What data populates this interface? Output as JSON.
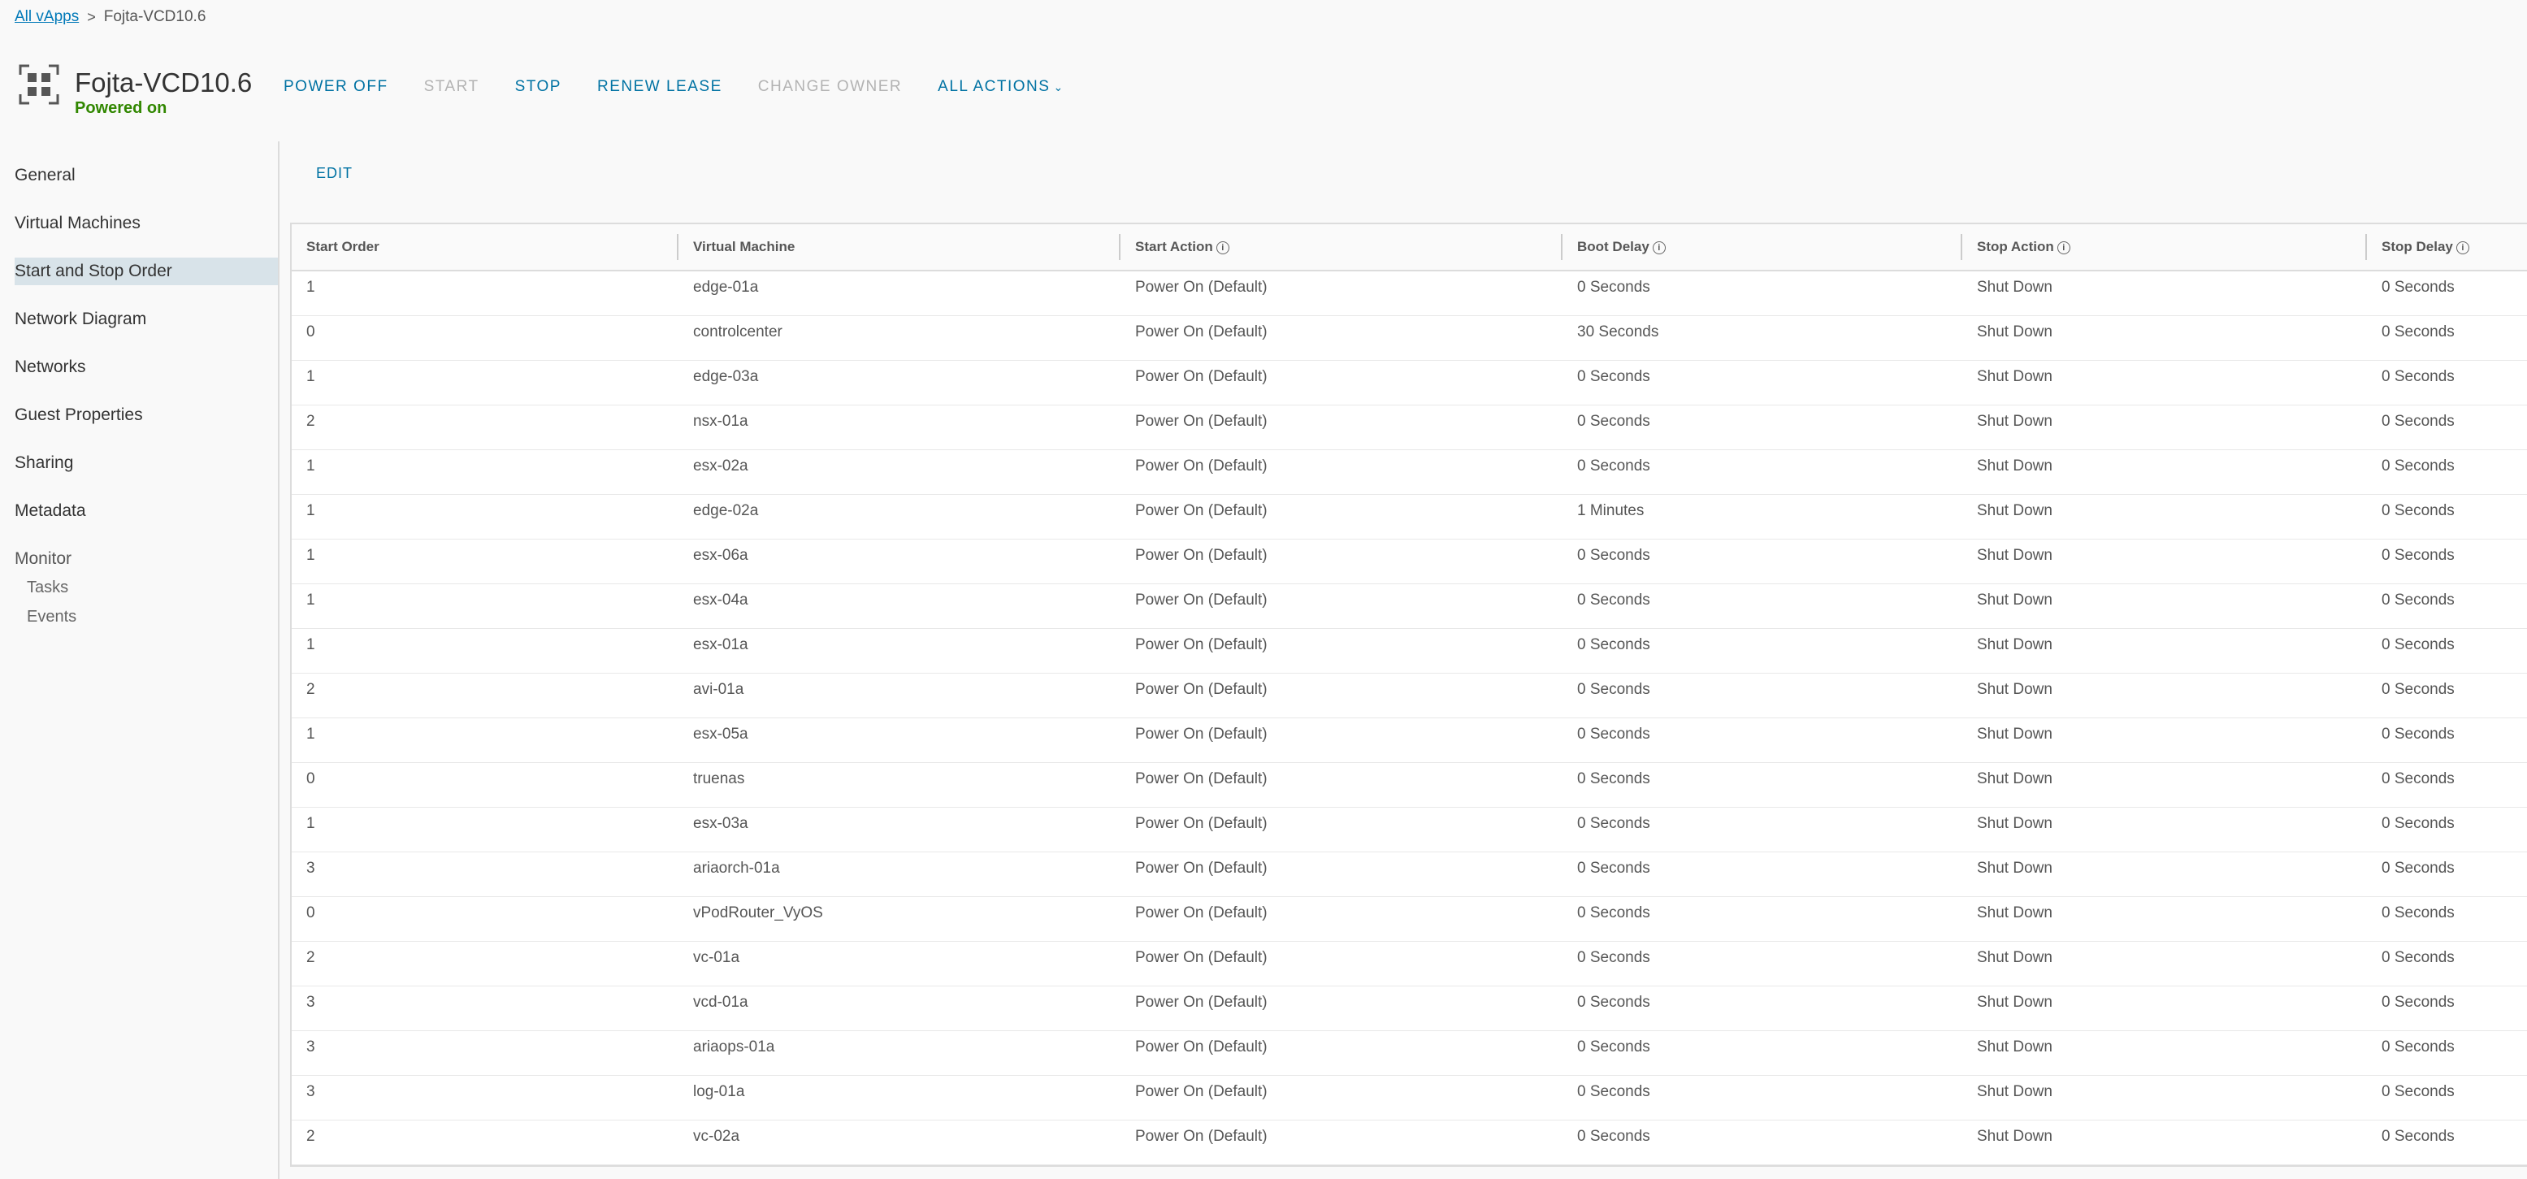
{
  "breadcrumb": {
    "root": "All vApps",
    "separator": ">",
    "current": "Fojta-VCD10.6"
  },
  "header": {
    "icon": "vapp-icon",
    "title": "Fojta-VCD10.6",
    "status": "Powered on",
    "status_color": "#318700"
  },
  "actions": [
    {
      "label": "POWER OFF",
      "enabled": true
    },
    {
      "label": "START",
      "enabled": false
    },
    {
      "label": "STOP",
      "enabled": true
    },
    {
      "label": "RENEW LEASE",
      "enabled": true
    },
    {
      "label": "CHANGE OWNER",
      "enabled": false
    },
    {
      "label": "ALL ACTIONS",
      "enabled": true,
      "icon": "chevron-down-icon"
    }
  ],
  "sidebar": {
    "items": [
      {
        "label": "General"
      },
      {
        "label": "Virtual Machines"
      },
      {
        "label": "Start and Stop Order",
        "active": true
      },
      {
        "label": "Network Diagram"
      },
      {
        "label": "Networks"
      },
      {
        "label": "Guest Properties"
      },
      {
        "label": "Sharing"
      },
      {
        "label": "Metadata"
      }
    ],
    "monitor": {
      "label": "Monitor",
      "children": [
        "Tasks",
        "Events"
      ]
    }
  },
  "edit_label": "EDIT",
  "table": {
    "columns": [
      {
        "label": "Start Order",
        "info": false
      },
      {
        "label": "Virtual Machine",
        "info": false
      },
      {
        "label": "Start Action",
        "info": true
      },
      {
        "label": "Boot Delay",
        "info": true
      },
      {
        "label": "Stop Action",
        "info": true
      },
      {
        "label": "Stop Delay",
        "info": true
      }
    ],
    "rows": [
      [
        "1",
        "edge-01a",
        "Power On (Default)",
        "0 Seconds",
        "Shut Down",
        "0 Seconds"
      ],
      [
        "0",
        "controlcenter",
        "Power On (Default)",
        "30 Seconds",
        "Shut Down",
        "0 Seconds"
      ],
      [
        "1",
        "edge-03a",
        "Power On (Default)",
        "0 Seconds",
        "Shut Down",
        "0 Seconds"
      ],
      [
        "2",
        "nsx-01a",
        "Power On (Default)",
        "0 Seconds",
        "Shut Down",
        "0 Seconds"
      ],
      [
        "1",
        "esx-02a",
        "Power On (Default)",
        "0 Seconds",
        "Shut Down",
        "0 Seconds"
      ],
      [
        "1",
        "edge-02a",
        "Power On (Default)",
        "1 Minutes",
        "Shut Down",
        "0 Seconds"
      ],
      [
        "1",
        "esx-06a",
        "Power On (Default)",
        "0 Seconds",
        "Shut Down",
        "0 Seconds"
      ],
      [
        "1",
        "esx-04a",
        "Power On (Default)",
        "0 Seconds",
        "Shut Down",
        "0 Seconds"
      ],
      [
        "1",
        "esx-01a",
        "Power On (Default)",
        "0 Seconds",
        "Shut Down",
        "0 Seconds"
      ],
      [
        "2",
        "avi-01a",
        "Power On (Default)",
        "0 Seconds",
        "Shut Down",
        "0 Seconds"
      ],
      [
        "1",
        "esx-05a",
        "Power On (Default)",
        "0 Seconds",
        "Shut Down",
        "0 Seconds"
      ],
      [
        "0",
        "truenas",
        "Power On (Default)",
        "0 Seconds",
        "Shut Down",
        "0 Seconds"
      ],
      [
        "1",
        "esx-03a",
        "Power On (Default)",
        "0 Seconds",
        "Shut Down",
        "0 Seconds"
      ],
      [
        "3",
        "ariaorch-01a",
        "Power On (Default)",
        "0 Seconds",
        "Shut Down",
        "0 Seconds"
      ],
      [
        "0",
        "vPodRouter_VyOS",
        "Power On (Default)",
        "0 Seconds",
        "Shut Down",
        "0 Seconds"
      ],
      [
        "2",
        "vc-01a",
        "Power On (Default)",
        "0 Seconds",
        "Shut Down",
        "0 Seconds"
      ],
      [
        "3",
        "vcd-01a",
        "Power On (Default)",
        "0 Seconds",
        "Shut Down",
        "0 Seconds"
      ],
      [
        "3",
        "ariaops-01a",
        "Power On (Default)",
        "0 Seconds",
        "Shut Down",
        "0 Seconds"
      ],
      [
        "3",
        "log-01a",
        "Power On (Default)",
        "0 Seconds",
        "Shut Down",
        "0 Seconds"
      ],
      [
        "2",
        "vc-02a",
        "Power On (Default)",
        "0 Seconds",
        "Shut Down",
        "0 Seconds"
      ]
    ]
  }
}
